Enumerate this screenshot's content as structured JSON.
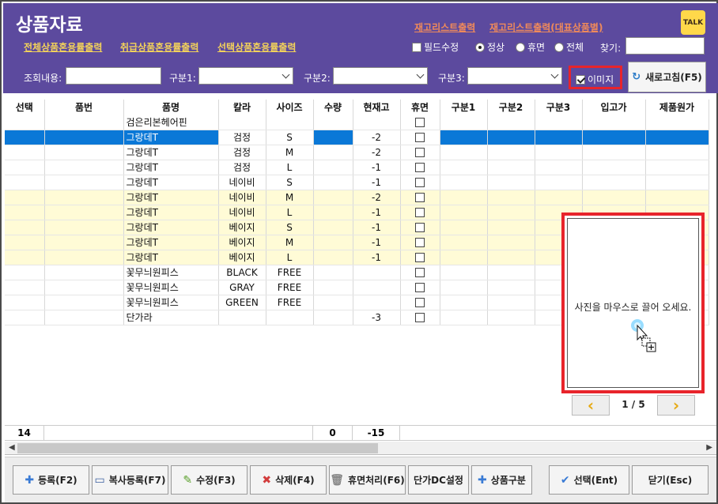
{
  "header": {
    "title": "상품자료",
    "links": [
      "전체상품혼용률출력",
      "취급상품혼용률출력",
      "선택상품혼용률출력"
    ],
    "stock_links": [
      "재고리스트출력",
      "재고리스트출력(대표상품별)"
    ],
    "talk_label": "TALK"
  },
  "options": {
    "field_edit": "필드수정",
    "radio_normal": "정상",
    "radio_dormant": "휴면",
    "radio_all": "전체",
    "find_label": "찾기:",
    "find_value": "",
    "query_label": "조회내용:",
    "query_value": "",
    "cat1_label": "구분1:",
    "cat2_label": "구분2:",
    "cat3_label": "구분3:",
    "image_label": "이미지",
    "refresh_label": "새로고침(F5)"
  },
  "grid": {
    "columns": [
      "선택",
      "품번",
      "품명",
      "칼라",
      "사이즈",
      "수량",
      "현재고",
      "휴면",
      "구분1",
      "구분2",
      "구분3",
      "입고가",
      "제품원가"
    ],
    "rows": [
      {
        "name": "검은리본헤어핀",
        "color": "",
        "size": "",
        "qty": "",
        "stock": "",
        "style": ""
      },
      {
        "name": "그랑데T",
        "color": "검정",
        "size": "S",
        "qty": "",
        "stock": "-2",
        "style": "selected"
      },
      {
        "name": "그랑데T",
        "color": "검정",
        "size": "M",
        "qty": "",
        "stock": "-2",
        "style": ""
      },
      {
        "name": "그랑데T",
        "color": "검정",
        "size": "L",
        "qty": "",
        "stock": "-1",
        "style": ""
      },
      {
        "name": "그랑데T",
        "color": "네이비",
        "size": "S",
        "qty": "",
        "stock": "-1",
        "style": ""
      },
      {
        "name": "그랑데T",
        "color": "네이비",
        "size": "M",
        "qty": "",
        "stock": "-2",
        "style": "yellow"
      },
      {
        "name": "그랑데T",
        "color": "네이비",
        "size": "L",
        "qty": "",
        "stock": "-1",
        "style": "yellow"
      },
      {
        "name": "그랑데T",
        "color": "베이지",
        "size": "S",
        "qty": "",
        "stock": "-1",
        "style": "yellow"
      },
      {
        "name": "그랑데T",
        "color": "베이지",
        "size": "M",
        "qty": "",
        "stock": "-1",
        "style": "yellow"
      },
      {
        "name": "그랑데T",
        "color": "베이지",
        "size": "L",
        "qty": "",
        "stock": "-1",
        "style": "yellow"
      },
      {
        "name": "꽃무늬원피스",
        "color": "BLACK",
        "size": "FREE",
        "qty": "",
        "stock": "",
        "style": ""
      },
      {
        "name": "꽃무늬원피스",
        "color": "GRAY",
        "size": "FREE",
        "qty": "",
        "stock": "",
        "style": ""
      },
      {
        "name": "꽃무늬원피스",
        "color": "GREEN",
        "size": "FREE",
        "qty": "",
        "stock": "",
        "style": ""
      },
      {
        "name": "단가라",
        "color": "",
        "size": "",
        "qty": "",
        "stock": "-3",
        "style": ""
      }
    ]
  },
  "image_panel": {
    "hint": "사진을 마우스로 끌어 오세요.",
    "page": "1 / 5"
  },
  "footer": {
    "count": "14",
    "qty_total": "0",
    "stock_total": "-15"
  },
  "buttons": [
    "등록(F2)",
    "복사등록(F7)",
    "수정(F3)",
    "삭제(F4)",
    "휴면처리(F6)",
    "단가DC설정",
    "상품구분",
    "선택(Ent)",
    "닫기(Esc)"
  ]
}
